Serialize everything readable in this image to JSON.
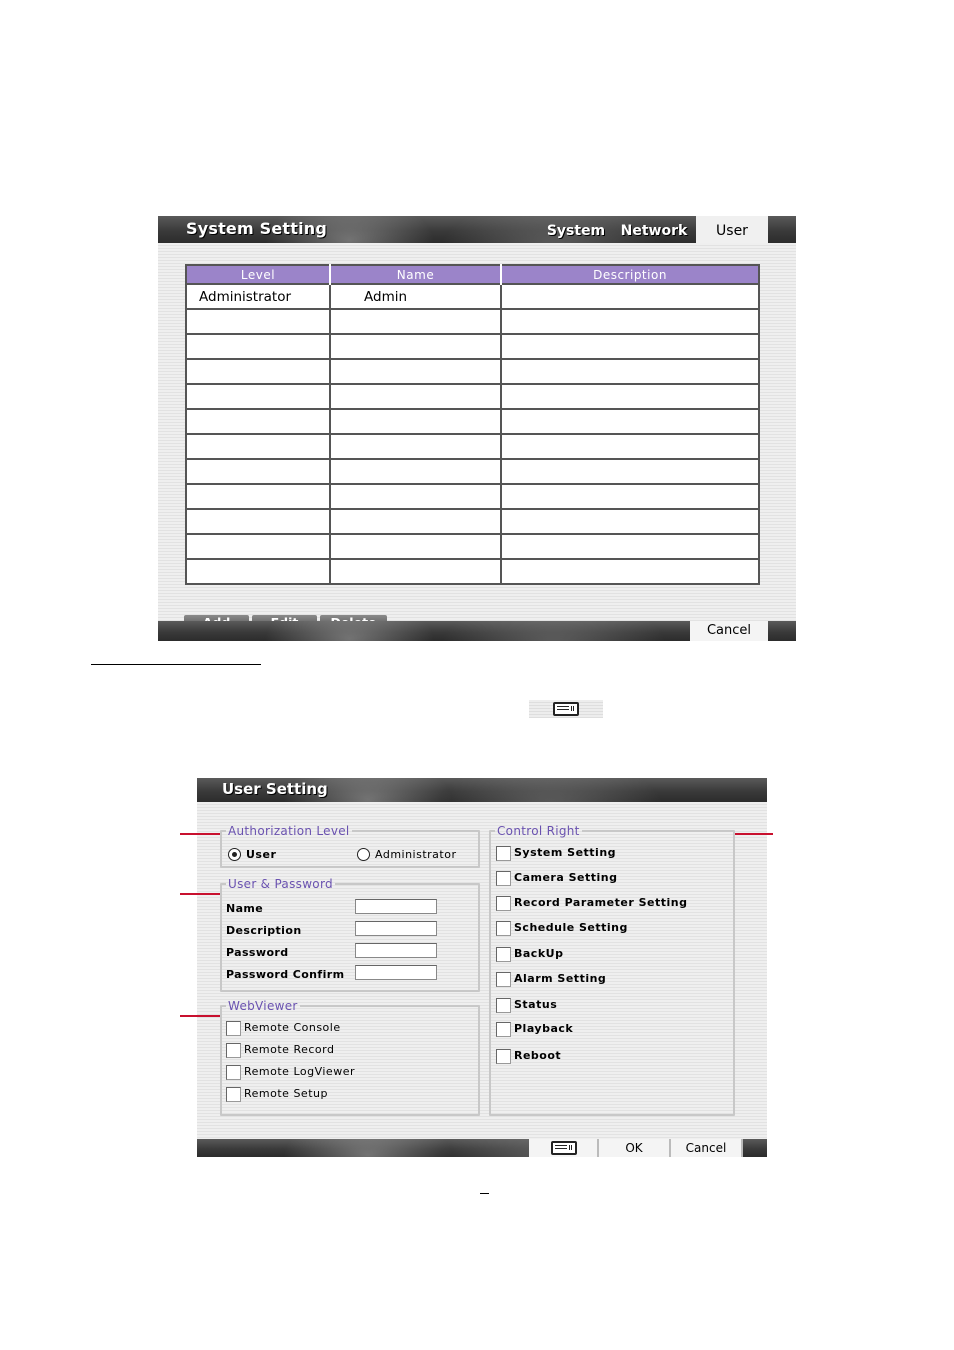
{
  "system_setting": {
    "title": "System Setting",
    "tabs": [
      {
        "label": "System",
        "active": false
      },
      {
        "label": "Network",
        "active": false
      },
      {
        "label": "User",
        "active": true
      }
    ],
    "table": {
      "columns": [
        "Level",
        "Name",
        "Description"
      ],
      "rows": [
        {
          "level": "Administrator",
          "name": "Admin",
          "description": ""
        },
        {
          "level": "",
          "name": "",
          "description": ""
        },
        {
          "level": "",
          "name": "",
          "description": ""
        },
        {
          "level": "",
          "name": "",
          "description": ""
        },
        {
          "level": "",
          "name": "",
          "description": ""
        },
        {
          "level": "",
          "name": "",
          "description": ""
        },
        {
          "level": "",
          "name": "",
          "description": ""
        },
        {
          "level": "",
          "name": "",
          "description": ""
        },
        {
          "level": "",
          "name": "",
          "description": ""
        },
        {
          "level": "",
          "name": "",
          "description": ""
        },
        {
          "level": "",
          "name": "",
          "description": ""
        },
        {
          "level": "",
          "name": "",
          "description": ""
        }
      ]
    },
    "buttons": {
      "add": "Add",
      "edit": "Edit",
      "delete": "Delete"
    },
    "footer": {
      "cancel": "Cancel"
    }
  },
  "inline_icon": {
    "name": "keyboard-icon"
  },
  "user_setting": {
    "title": "User Setting",
    "authorization": {
      "legend": "Authorization Level",
      "options": [
        {
          "label": "User",
          "checked": true
        },
        {
          "label": "Administrator",
          "checked": false
        }
      ]
    },
    "user_password": {
      "legend": "User & Password",
      "fields": [
        {
          "label": "Name",
          "value": ""
        },
        {
          "label": "Description",
          "value": ""
        },
        {
          "label": "Password",
          "value": ""
        },
        {
          "label": "Password Confirm",
          "value": ""
        }
      ]
    },
    "webviewer": {
      "legend": "WebViewer",
      "items": [
        {
          "label": "Remote Console",
          "checked": false
        },
        {
          "label": "Remote Record",
          "checked": false
        },
        {
          "label": "Remote LogViewer",
          "checked": false
        },
        {
          "label": "Remote Setup",
          "checked": false
        }
      ]
    },
    "control_right": {
      "legend": "Control Right",
      "items": [
        {
          "label": "System Setting",
          "checked": false
        },
        {
          "label": "Camera Setting",
          "checked": false
        },
        {
          "label": "Record Parameter Setting",
          "checked": false
        },
        {
          "label": "Schedule Setting",
          "checked": false
        },
        {
          "label": "BackUp",
          "checked": false
        },
        {
          "label": "Alarm Setting",
          "checked": false
        },
        {
          "label": "Status",
          "checked": false
        },
        {
          "label": "Playback",
          "checked": false
        },
        {
          "label": "Reboot",
          "checked": false
        }
      ]
    },
    "footer": {
      "keyboard_icon": "keyboard-icon",
      "ok": "OK",
      "cancel": "Cancel"
    }
  },
  "colors": {
    "table_header": "#9b84c9",
    "group_legend": "#6a52b0",
    "callout_line": "#c8102e"
  }
}
